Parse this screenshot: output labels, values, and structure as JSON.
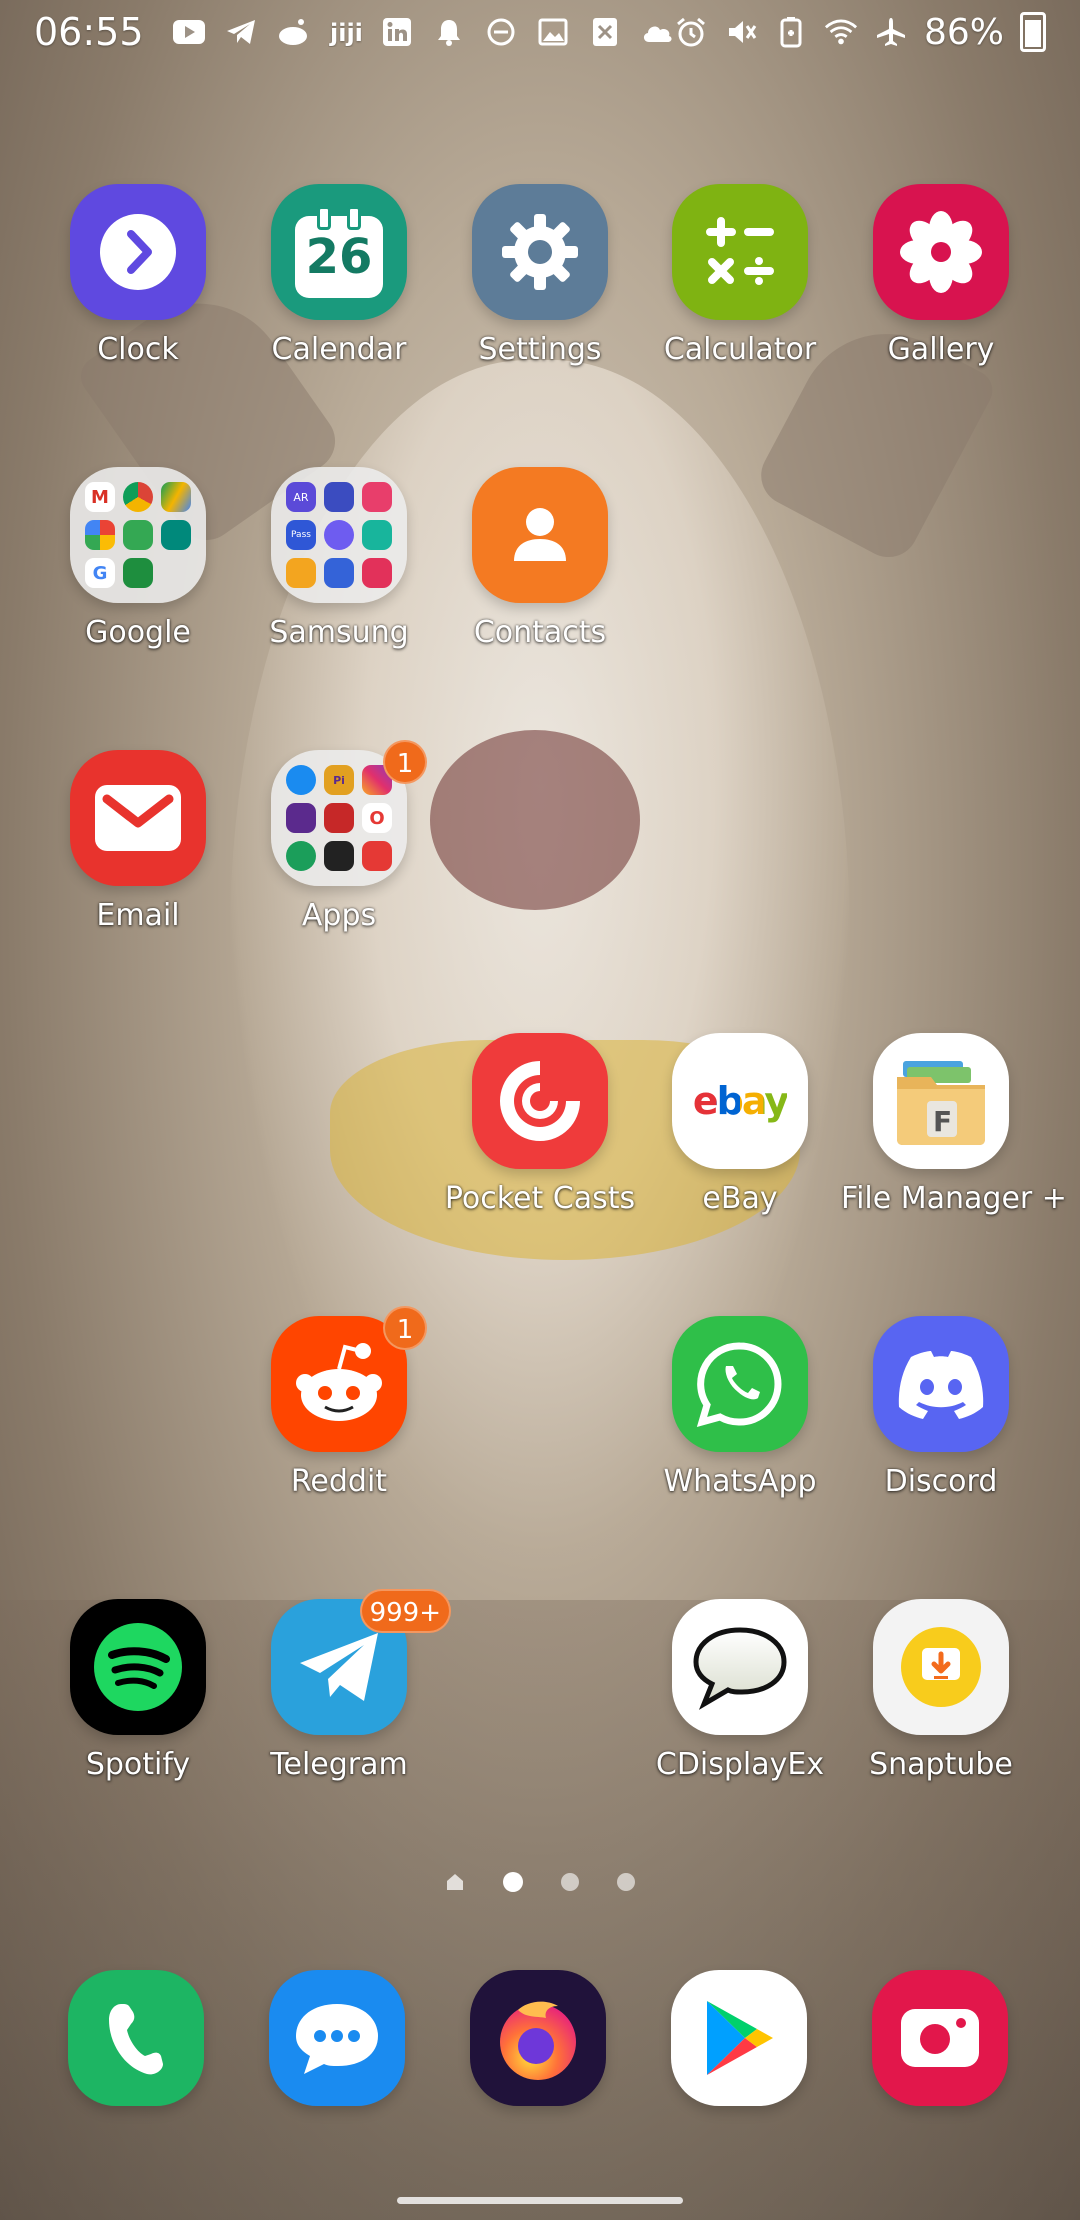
{
  "status_bar": {
    "time": "06:55",
    "left_icons": [
      "youtube-icon",
      "telegram-icon",
      "reddit-icon",
      "jiji-icon",
      "linkedin-icon",
      "bell-icon",
      "dnd-icon",
      "image-icon",
      "x-icon",
      "cloud-icon"
    ],
    "right_icons": [
      "alarm-icon",
      "mute-vibrate-icon",
      "battery-saver-icon",
      "wifi-icon",
      "airplane-icon"
    ],
    "battery": "86%"
  },
  "apps": {
    "clock": {
      "label": "Clock"
    },
    "calendar": {
      "label": "Calendar",
      "date": "26"
    },
    "settings": {
      "label": "Settings"
    },
    "calculator": {
      "label": "Calculator"
    },
    "gallery": {
      "label": "Gallery"
    },
    "google": {
      "label": "Google"
    },
    "samsung": {
      "label": "Samsung"
    },
    "contacts": {
      "label": "Contacts"
    },
    "email": {
      "label": "Email"
    },
    "apps_folder": {
      "label": "Apps",
      "badge": "1"
    },
    "pocket_casts": {
      "label": "Pocket Casts"
    },
    "ebay": {
      "label": "eBay",
      "logo": "ebay"
    },
    "file_manager": {
      "label": "File Manager +"
    },
    "reddit": {
      "label": "Reddit",
      "badge": "1"
    },
    "whatsapp": {
      "label": "WhatsApp"
    },
    "discord": {
      "label": "Discord"
    },
    "spotify": {
      "label": "Spotify"
    },
    "telegram": {
      "label": "Telegram",
      "badge": "999+"
    },
    "cdisplayex": {
      "label": "CDisplayEx"
    },
    "snaptube": {
      "label": "Snaptube"
    }
  },
  "folder_tiles": {
    "samsung": {
      "ar": "AR",
      "pass": "Pass"
    },
    "apps": {
      "pi": "Pi"
    }
  },
  "pager": {
    "total_pages": 3,
    "current_page": 1
  },
  "dock": [
    "phone",
    "messages",
    "firefox",
    "play-store",
    "camera"
  ],
  "colors": {
    "badge": "#f06a1b"
  }
}
